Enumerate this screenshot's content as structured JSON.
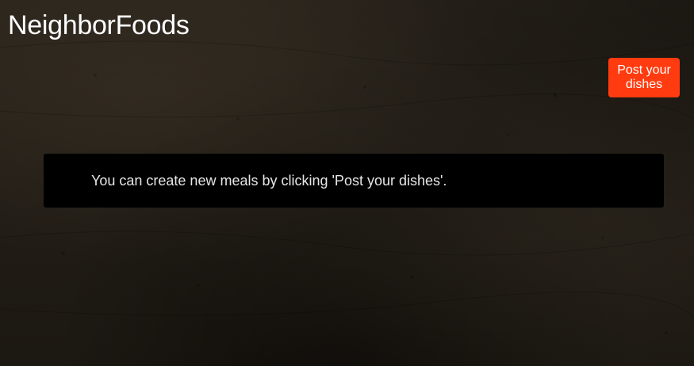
{
  "header": {
    "brand": "NeighborFoods"
  },
  "actions": {
    "post_dishes_label": "Post your dishes"
  },
  "main": {
    "info_message": "You can create new meals by clicking 'Post your dishes'."
  },
  "colors": {
    "background": "#241f18",
    "accent_button": "#ff3b0f",
    "panel": "#000000",
    "text": "#ffffff"
  }
}
